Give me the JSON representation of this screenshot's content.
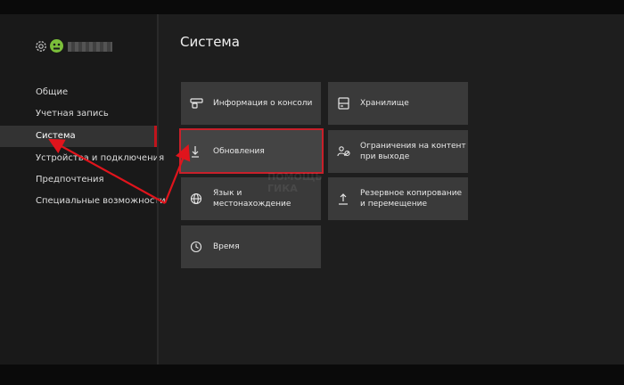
{
  "app": {
    "title": "Система"
  },
  "sidebar": {
    "items": [
      {
        "label": "Общие"
      },
      {
        "label": "Учетная запись"
      },
      {
        "label": "Система"
      },
      {
        "label": "Устройства и подключения"
      },
      {
        "label": "Предпочтения"
      },
      {
        "label": "Специальные возможности"
      }
    ]
  },
  "tiles": {
    "console_info": "Информация о консоли",
    "storage": "Хранилище",
    "updates": "Обновления",
    "content_limits": [
      "Ограничения на контент",
      "при выходе"
    ],
    "language": [
      "Язык и",
      "местонахождение"
    ],
    "backup": [
      "Резервное копирование",
      "и перемещение"
    ],
    "time": "Время"
  },
  "watermark": {
    "line1": "ПОМОЩЬ",
    "line2": "ГИКА"
  },
  "colors": {
    "accent": "#c8202a",
    "tile": "#3a3a3a",
    "background": "#1e1e1e"
  }
}
